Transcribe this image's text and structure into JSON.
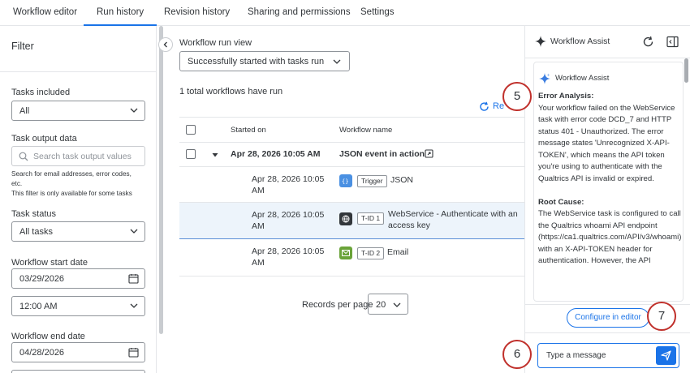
{
  "tabs": [
    "Workflow editor",
    "Run history",
    "Revision history",
    "Sharing and permissions",
    "Settings"
  ],
  "filter": {
    "title": "Filter",
    "tasks_included_label": "Tasks included",
    "tasks_included_value": "All",
    "task_output_label": "Task output data",
    "task_output_placeholder": "Search task output values",
    "hint1": "Search for email addresses, error codes,",
    "hint2": "etc.",
    "hint3": "This filter is only available for some tasks",
    "task_status_label": "Task status",
    "task_status_value": "All tasks",
    "start_date_label": "Workflow start date",
    "start_date_value": "03/29/2026",
    "start_time_value": "12:00 AM",
    "end_date_label": "Workflow end date",
    "end_date_value": "04/28/2026"
  },
  "main": {
    "run_view_label": "Workflow run view",
    "run_view_value": "Successfully started with tasks run",
    "count_text": "1 total workflows have run",
    "refresh_label": "Re",
    "columns": [
      "Started on",
      "Workflow name"
    ],
    "run": {
      "started": "Apr 28, 2026 10:05 AM",
      "name": "JSON event in action"
    },
    "tasks": [
      {
        "started_line1": "Apr 28, 2026 10:05",
        "started_line2": "AM",
        "tag": "Trigger",
        "name_line1": "JSON",
        "name_line2": "",
        "icon_color": "#4a90e2"
      },
      {
        "started_line1": "Apr 28, 2026 10:05",
        "started_line2": "AM",
        "tag": "T-ID 1",
        "name_line1": "WebService - Authenticate with an",
        "name_line2": "access key",
        "icon_color": "#32363a"
      },
      {
        "started_line1": "Apr 28, 2026 10:05",
        "started_line2": "AM",
        "tag": "T-ID 2",
        "name_line1": "Email",
        "name_line2": "",
        "icon_color": "#6aa339"
      }
    ],
    "records_per_page_label": "Records per page",
    "records_per_page_value": "20"
  },
  "assist": {
    "header_title": "Workflow Assist",
    "message_title": "Workflow Assist",
    "error_heading": "Error Analysis:",
    "error_text": "Your workflow failed on the WebService task with error code DCD_7 and HTTP status 401 - Unauthorized. The error message states 'Unrecognized X-API-TOKEN', which means the API token you're using to authenticate with the Qualtrics API is invalid or expired.",
    "cause_heading": "Root Cause:",
    "cause_text": "The WebService task is configured to call the Qualtrics whoami API endpoint (https://ca1.qualtrics.com/API/v3/whoami) with an X-API-TOKEN header for authentication. However, the API",
    "configure_button": "Configure in editor",
    "input_placeholder": "Type a message"
  },
  "callouts": [
    "5",
    "6",
    "7"
  ],
  "colors": {
    "accent": "#1a73e8",
    "callout": "#c0302b",
    "selected_row": "#edf4fb"
  }
}
